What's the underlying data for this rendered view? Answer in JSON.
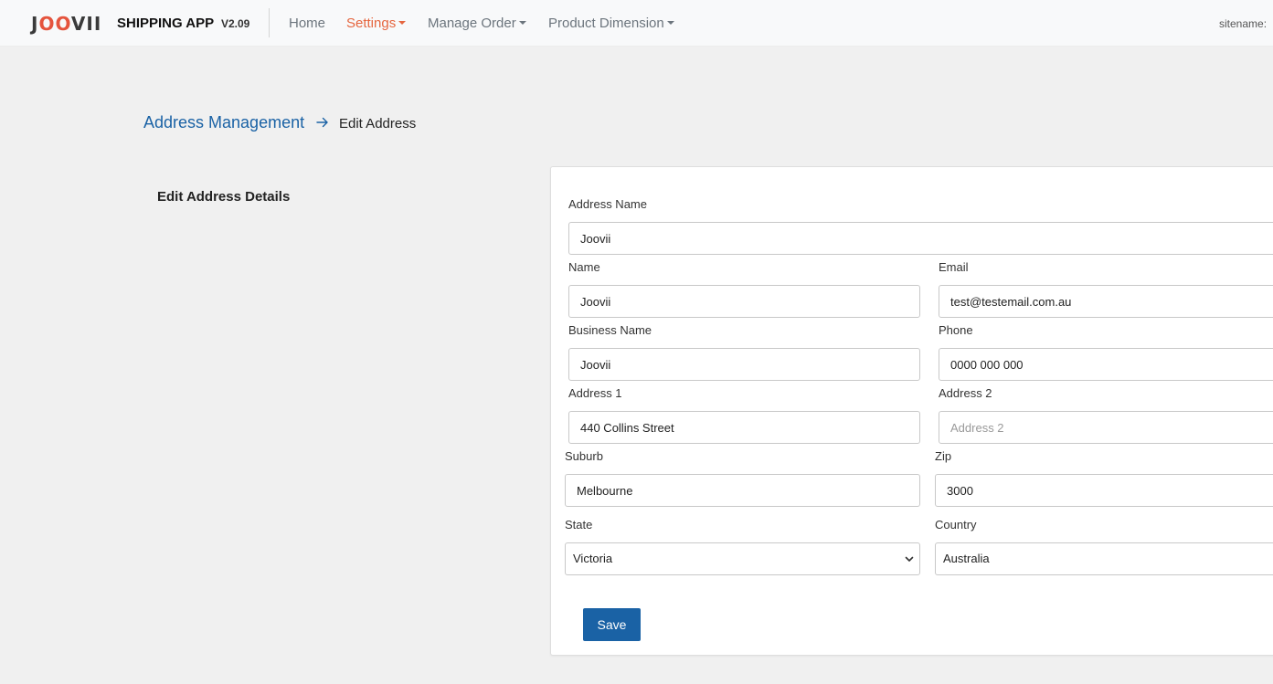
{
  "navbar": {
    "logo": {
      "prefix": "J",
      "oo": "OO",
      "suffix": "VII"
    },
    "app_title": "SHIPPING APP",
    "version": "V2.09",
    "links": [
      {
        "label": "Home",
        "active": false,
        "dropdown": false
      },
      {
        "label": "Settings",
        "active": true,
        "dropdown": true
      },
      {
        "label": "Manage Order",
        "active": false,
        "dropdown": true
      },
      {
        "label": "Product Dimension",
        "active": false,
        "dropdown": true
      }
    ],
    "sitename_label": "sitename:"
  },
  "breadcrumb": {
    "parent": "Address Management",
    "current": "Edit Address"
  },
  "section_title": "Edit Address Details",
  "form": {
    "address_name": {
      "label": "Address Name",
      "value": "Joovii"
    },
    "name": {
      "label": "Name",
      "value": "Joovii"
    },
    "email": {
      "label": "Email",
      "value": "test@testemail.com.au"
    },
    "business_name": {
      "label": "Business Name",
      "value": "Joovii"
    },
    "phone": {
      "label": "Phone",
      "value": "0000 000 000"
    },
    "address1": {
      "label": "Address 1",
      "value": "440 Collins Street"
    },
    "address2": {
      "label": "Address 2",
      "value": "",
      "placeholder": "Address 2"
    },
    "suburb": {
      "label": "Suburb",
      "value": "Melbourne"
    },
    "zip": {
      "label": "Zip",
      "value": "3000"
    },
    "state": {
      "label": "State",
      "value": "Victoria"
    },
    "country": {
      "label": "Country",
      "value": "Australia"
    },
    "save_label": "Save"
  },
  "colors": {
    "brand_orange": "#e5663f",
    "link_blue": "#1a62a5",
    "background": "#f0f0f0"
  }
}
